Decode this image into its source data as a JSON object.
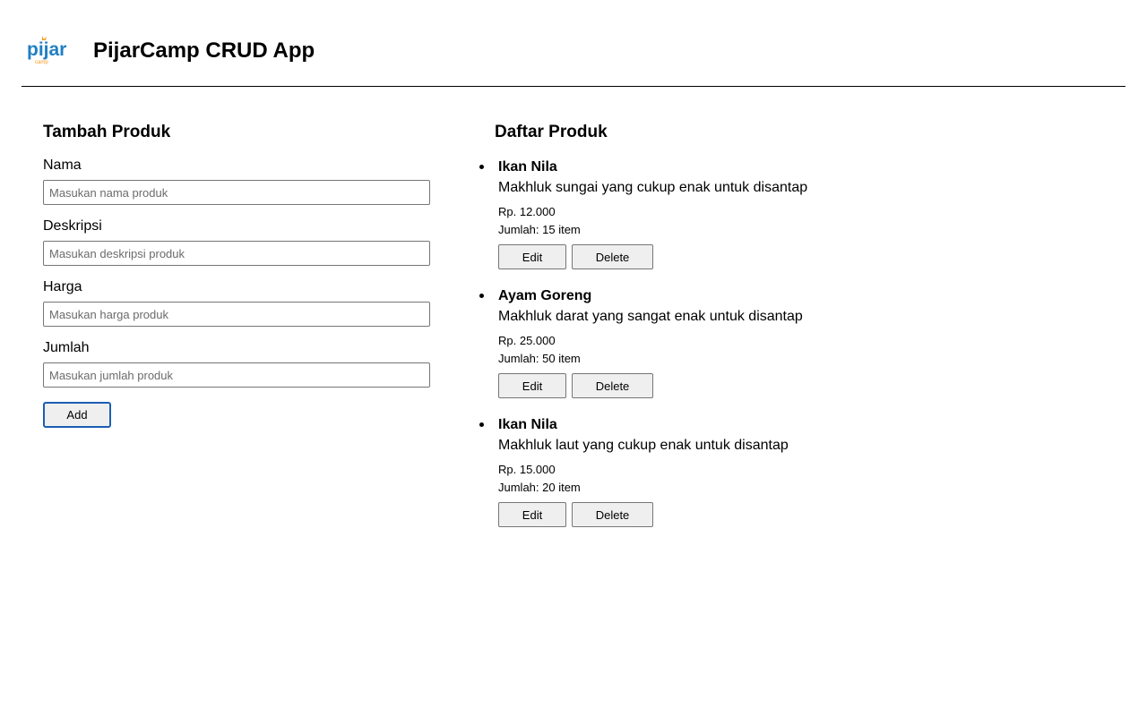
{
  "header": {
    "logo_text": "pijar",
    "logo_subtext": "camp",
    "title": "PijarCamp CRUD App"
  },
  "form": {
    "title": "Tambah Produk",
    "fields": [
      {
        "label": "Nama",
        "placeholder": "Masukan nama produk",
        "value": ""
      },
      {
        "label": "Deskripsi",
        "placeholder": "Masukan deskripsi produk",
        "value": ""
      },
      {
        "label": "Harga",
        "placeholder": "Masukan harga produk",
        "value": ""
      },
      {
        "label": "Jumlah",
        "placeholder": "Masukan jumlah produk",
        "value": ""
      }
    ],
    "add_label": "Add"
  },
  "list": {
    "title": "Daftar Produk",
    "products": [
      {
        "name": "Ikan Nila",
        "description": "Makhluk sungai yang cukup enak untuk disantap",
        "price": "Rp. 12.000",
        "quantity": "Jumlah: 15 item",
        "edit_label": "Edit",
        "delete_label": "Delete"
      },
      {
        "name": "Ayam Goreng",
        "description": "Makhluk darat yang sangat enak untuk disantap",
        "price": "Rp. 25.000",
        "quantity": "Jumlah: 50 item",
        "edit_label": "Edit",
        "delete_label": "Delete"
      },
      {
        "name": "Ikan Nila",
        "description": "Makhluk laut yang cukup enak untuk disantap",
        "price": "Rp. 15.000",
        "quantity": "Jumlah: 20 item",
        "edit_label": "Edit",
        "delete_label": "Delete"
      }
    ]
  },
  "colors": {
    "logo_blue": "#1f7fc4",
    "logo_orange": "#f39c23",
    "focus_border": "#1a5fb4"
  }
}
